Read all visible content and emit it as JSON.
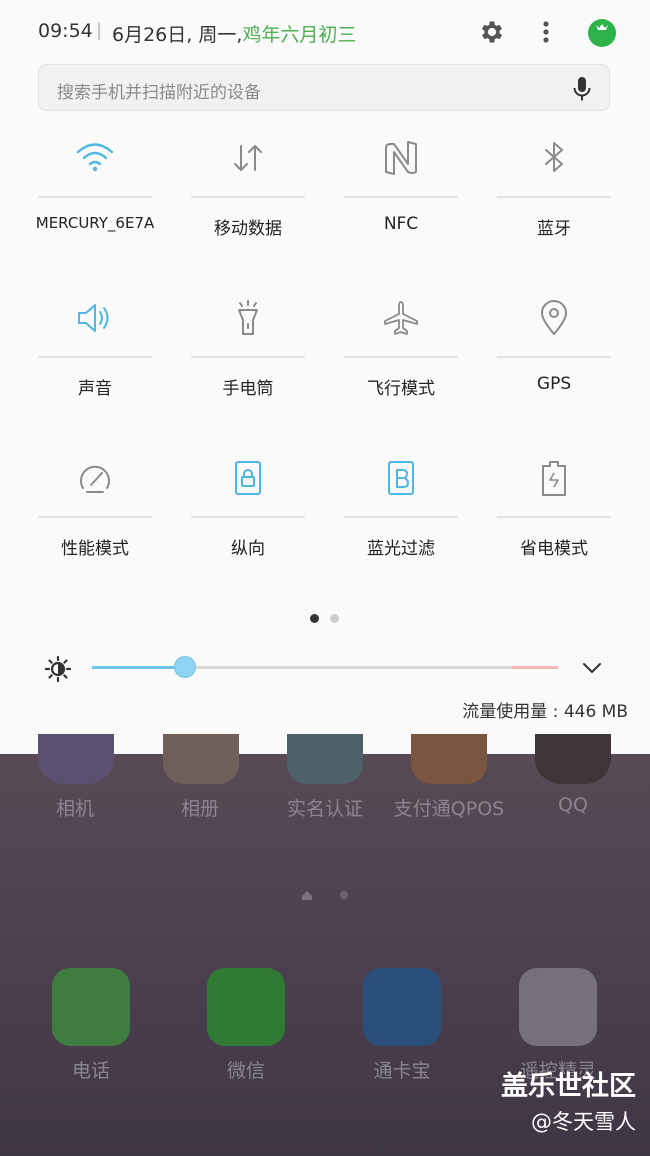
{
  "status": {
    "time": "09:54",
    "separator": "|",
    "date": "6月26日, 周一,",
    "lunar": "鸡年六月初三"
  },
  "search": {
    "placeholder": "搜索手机并扫描附近的设备"
  },
  "tiles": [
    {
      "label": "MERCURY_6E7A",
      "icon": "wifi-icon",
      "active": true
    },
    {
      "label": "移动数据",
      "icon": "mobile-data-icon",
      "active": false
    },
    {
      "label": "NFC",
      "icon": "nfc-icon",
      "active": false
    },
    {
      "label": "蓝牙",
      "icon": "bluetooth-icon",
      "active": false
    },
    {
      "label": "声音",
      "icon": "sound-icon",
      "active": true
    },
    {
      "label": "手电筒",
      "icon": "flashlight-icon",
      "active": false
    },
    {
      "label": "飞行模式",
      "icon": "airplane-icon",
      "active": false
    },
    {
      "label": "GPS",
      "icon": "location-icon",
      "active": false
    },
    {
      "label": "性能模式",
      "icon": "performance-icon",
      "active": false
    },
    {
      "label": "纵向",
      "icon": "portrait-lock-icon",
      "active": true
    },
    {
      "label": "蓝光过滤",
      "icon": "blue-light-filter-icon",
      "active": true
    },
    {
      "label": "省电模式",
      "icon": "power-saving-icon",
      "active": false
    }
  ],
  "page_indicator": {
    "pages": 2,
    "current": 1
  },
  "brightness": {
    "level": 0.2
  },
  "data_usage": "流量使用量 : 446 MB",
  "colors": {
    "accent": "#4fb6e3",
    "lunar_green": "#4caf50",
    "inactive_icon": "#8a8a8a"
  },
  "home": {
    "top_row": [
      "相机",
      "相册",
      "实名认证",
      "支付通QPOS",
      "QQ"
    ],
    "dock": [
      "电话",
      "微信",
      "通卡宝",
      "遥控精灵"
    ]
  },
  "watermark": {
    "line1": "盖乐世社区",
    "line2": "@冬天雪人"
  }
}
